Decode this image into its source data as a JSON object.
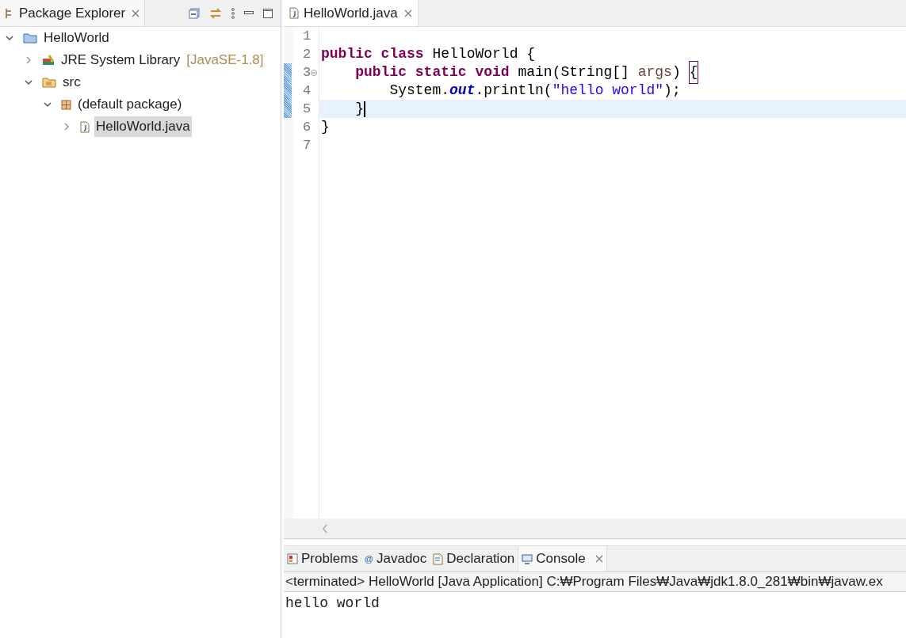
{
  "explorer": {
    "title": "Package Explorer",
    "tree": [
      {
        "label": "HelloWorld",
        "kind": "project",
        "expanded": true,
        "selected": false,
        "children": [
          {
            "label": "JRE System Library",
            "decoration": "[JavaSE-1.8]",
            "kind": "library",
            "expanded": false,
            "selected": false
          },
          {
            "label": "src",
            "kind": "source",
            "expanded": true,
            "selected": false,
            "children": [
              {
                "label": "(default package)",
                "kind": "package",
                "expanded": true,
                "selected": false,
                "children": [
                  {
                    "label": "HelloWorld.java",
                    "kind": "file",
                    "expanded": false,
                    "selected": true
                  }
                ]
              }
            ]
          }
        ]
      }
    ]
  },
  "editor": {
    "tab": "HelloWorld.java",
    "lines": [
      {
        "number": "1",
        "current": false,
        "fold": false,
        "changed": false
      },
      {
        "number": "2",
        "current": false,
        "fold": false,
        "changed": false,
        "tokens": [
          {
            "kind": "keyword",
            "text": "public class"
          },
          {
            "kind": "plain",
            "text": " HelloWorld {"
          }
        ]
      },
      {
        "number": "3",
        "current": false,
        "fold": true,
        "changed": true,
        "tokens": [
          {
            "kind": "keyword",
            "text": "    public static void"
          },
          {
            "kind": "plain",
            "text": " main(String[] "
          },
          {
            "kind": "param",
            "text": "args"
          },
          {
            "kind": "plain",
            "text": ") "
          },
          {
            "kind": "bracket",
            "text": "{"
          }
        ]
      },
      {
        "number": "4",
        "current": false,
        "fold": false,
        "changed": true,
        "tokens": [
          {
            "kind": "plain",
            "text": "        System."
          },
          {
            "kind": "field",
            "text": "out"
          },
          {
            "kind": "plain",
            "text": ".println("
          },
          {
            "kind": "string",
            "text": "\"hello world\""
          },
          {
            "kind": "plain",
            "text": ");"
          }
        ]
      },
      {
        "number": "5",
        "current": true,
        "fold": false,
        "changed": true,
        "tokens": [
          {
            "kind": "plain",
            "text": "    }"
          }
        ]
      },
      {
        "number": "6",
        "current": false,
        "fold": false,
        "changed": false,
        "tokens": [
          {
            "kind": "plain",
            "text": "}"
          }
        ]
      },
      {
        "number": "7",
        "current": false,
        "fold": false,
        "changed": false
      }
    ]
  },
  "bottom": {
    "tabs": [
      {
        "label": "Problems",
        "kind": "problems",
        "selected": false
      },
      {
        "label": "Javadoc",
        "kind": "javadoc",
        "icon": "@",
        "selected": false
      },
      {
        "label": "Declaration",
        "kind": "declaration",
        "selected": false
      },
      {
        "label": "Console",
        "kind": "console",
        "selected": true
      }
    ],
    "status": "<terminated> HelloWorld [Java Application] C:₩Program Files₩Java₩jdk1.8.0_281₩bin₩javaw.ex",
    "output": "hello world"
  }
}
